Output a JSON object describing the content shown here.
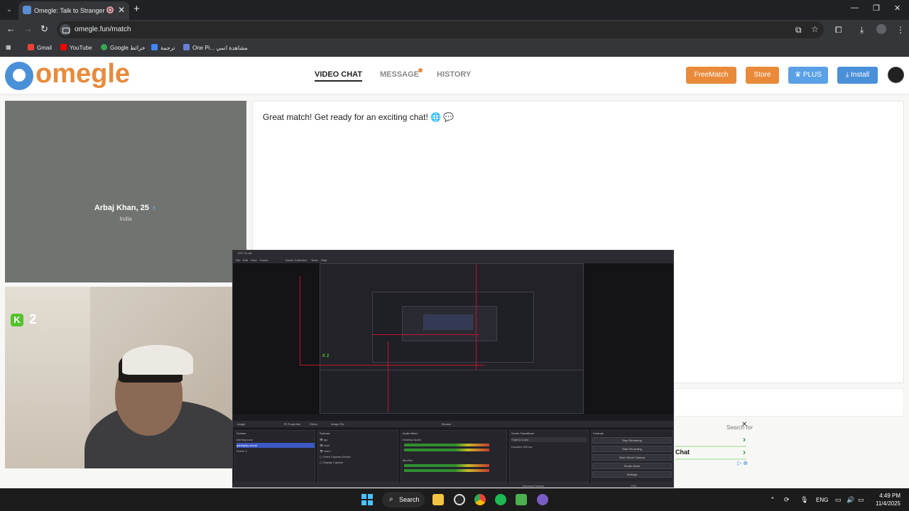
{
  "browser": {
    "tab_title": "Omegle: Talk to Strangers V",
    "url": "omegle.fun/match",
    "bookmarks": [
      "Gmail",
      "YouTube",
      "Google خرائط",
      "ترجمة",
      "One Pi... مشاهدة انمي"
    ]
  },
  "header": {
    "logo": "omegle",
    "nav": [
      "VIDEO CHAT",
      "MESSAGE",
      "HISTORY"
    ],
    "buttons": {
      "freematch": "FreeMatch",
      "store": "Store",
      "plus": "PLUS",
      "install": "Install"
    }
  },
  "stranger": {
    "name": "Arbaj Khan, 25",
    "country": "India"
  },
  "chat": {
    "message": "Great match! Get ready for an exciting chat! 🌐 💬"
  },
  "self_cam": {
    "badge_count": "2"
  },
  "ad": {
    "search": "Search for",
    "item": "Chat"
  },
  "taskbar": {
    "search": "Search",
    "language": "ENG",
    "time": "4:49 PM",
    "date": "11/4/2025"
  },
  "colors": {
    "brand_orange": "#e98a3a",
    "brand_blue": "#4a90d9",
    "plus_blue": "#5aa0e6"
  }
}
